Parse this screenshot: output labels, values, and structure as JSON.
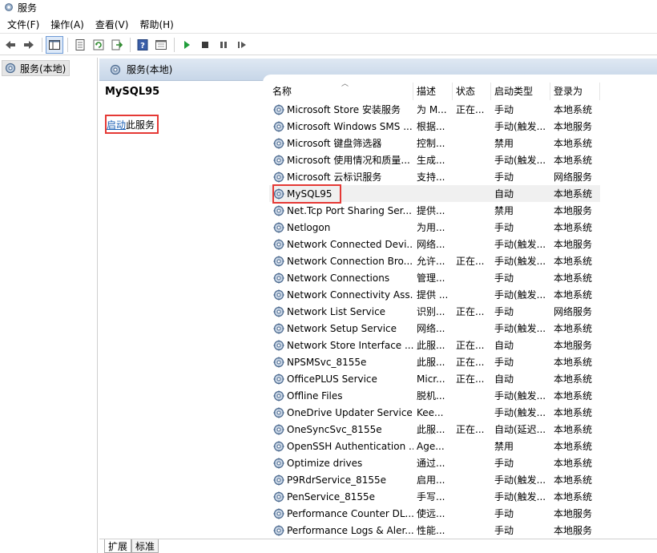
{
  "window": {
    "title": "服务"
  },
  "menu": [
    "文件(F)",
    "操作(A)",
    "查看(V)",
    "帮助(H)"
  ],
  "toolbar": {
    "buttons": [
      "back-icon",
      "forward-icon",
      "console-tree-icon",
      "properties-icon",
      "refresh-icon",
      "export-icon",
      "help-icon",
      "view-icon",
      "start-icon",
      "stop-icon",
      "pause-icon",
      "restart-icon"
    ]
  },
  "tree": {
    "root_label": "服务(本地)"
  },
  "pane": {
    "header": "服务(本地)",
    "selected_service": "MySQL95",
    "start_link": "启动",
    "start_suffix": "此服务"
  },
  "columns": {
    "name": "名称",
    "description": "描述",
    "status": "状态",
    "startup_type": "启动类型",
    "logon_as": "登录为"
  },
  "services": [
    {
      "name": "Microsoft Store 安装服务",
      "description": "为 M...",
      "status": "正在...",
      "startup": "手动",
      "logon": "本地系统"
    },
    {
      "name": "Microsoft Windows SMS ...",
      "description": "根据...",
      "status": "",
      "startup": "手动(触发...",
      "logon": "本地服务"
    },
    {
      "name": "Microsoft 键盘筛选器",
      "description": "控制...",
      "status": "",
      "startup": "禁用",
      "logon": "本地系统"
    },
    {
      "name": "Microsoft 使用情况和质量...",
      "description": "生成...",
      "status": "",
      "startup": "手动(触发...",
      "logon": "本地系统"
    },
    {
      "name": "Microsoft 云标识服务",
      "description": "支持...",
      "status": "",
      "startup": "手动",
      "logon": "网络服务"
    },
    {
      "name": "MySQL95",
      "description": "",
      "status": "",
      "startup": "自动",
      "logon": "本地系统"
    },
    {
      "name": "Net.Tcp Port Sharing Ser...",
      "description": "提供...",
      "status": "",
      "startup": "禁用",
      "logon": "本地服务"
    },
    {
      "name": "Netlogon",
      "description": "为用...",
      "status": "",
      "startup": "手动",
      "logon": "本地系统"
    },
    {
      "name": "Network Connected Devi...",
      "description": "网络...",
      "status": "",
      "startup": "手动(触发...",
      "logon": "本地服务"
    },
    {
      "name": "Network Connection Bro...",
      "description": "允许...",
      "status": "正在...",
      "startup": "手动(触发...",
      "logon": "本地系统"
    },
    {
      "name": "Network Connections",
      "description": "管理...",
      "status": "",
      "startup": "手动",
      "logon": "本地系统"
    },
    {
      "name": "Network Connectivity Ass...",
      "description": "提供 ...",
      "status": "",
      "startup": "手动(触发...",
      "logon": "本地系统"
    },
    {
      "name": "Network List Service",
      "description": "识别...",
      "status": "正在...",
      "startup": "手动",
      "logon": "网络服务"
    },
    {
      "name": "Network Setup Service",
      "description": "网络...",
      "status": "",
      "startup": "手动(触发...",
      "logon": "本地系统"
    },
    {
      "name": "Network Store Interface ...",
      "description": "此服...",
      "status": "正在...",
      "startup": "自动",
      "logon": "本地服务"
    },
    {
      "name": "NPSMSvc_8155e",
      "description": "此服...",
      "status": "正在...",
      "startup": "手动",
      "logon": "本地系统"
    },
    {
      "name": "OfficePLUS Service",
      "description": "Micr...",
      "status": "正在...",
      "startup": "自动",
      "logon": "本地系统"
    },
    {
      "name": "Offline Files",
      "description": "脱机...",
      "status": "",
      "startup": "手动(触发...",
      "logon": "本地系统"
    },
    {
      "name": "OneDrive Updater Service",
      "description": "Kee...",
      "status": "",
      "startup": "手动(触发...",
      "logon": "本地系统"
    },
    {
      "name": "OneSyncSvc_8155e",
      "description": "此服...",
      "status": "正在...",
      "startup": "自动(延迟...",
      "logon": "本地系统"
    },
    {
      "name": "OpenSSH Authentication ...",
      "description": "Age...",
      "status": "",
      "startup": "禁用",
      "logon": "本地系统"
    },
    {
      "name": "Optimize drives",
      "description": "通过...",
      "status": "",
      "startup": "手动",
      "logon": "本地系统"
    },
    {
      "name": "P9RdrService_8155e",
      "description": "启用...",
      "status": "",
      "startup": "手动(触发...",
      "logon": "本地系统"
    },
    {
      "name": "PenService_8155e",
      "description": "手写...",
      "status": "",
      "startup": "手动(触发...",
      "logon": "本地系统"
    },
    {
      "name": "Performance Counter DL...",
      "description": "使远...",
      "status": "",
      "startup": "手动",
      "logon": "本地服务"
    },
    {
      "name": "Performance Logs & Aler...",
      "description": "性能...",
      "status": "",
      "startup": "手动",
      "logon": "本地服务"
    }
  ],
  "selected_index": 5,
  "tabs": [
    "扩展",
    "标准"
  ]
}
